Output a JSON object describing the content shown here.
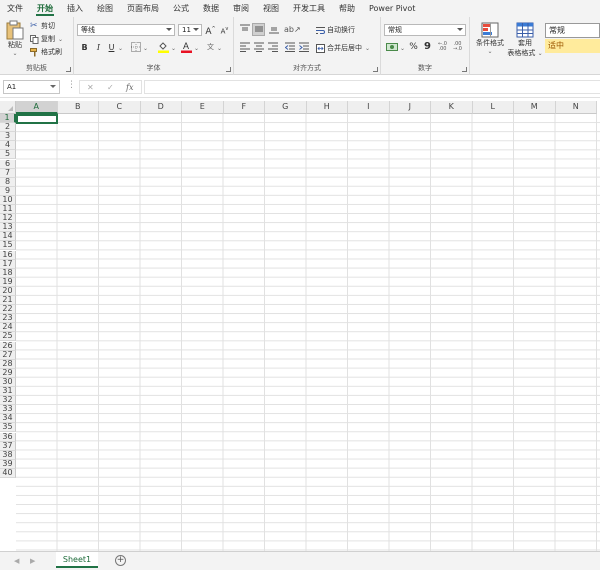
{
  "tabs": [
    "文件",
    "开始",
    "插入",
    "绘图",
    "页面布局",
    "公式",
    "数据",
    "审阅",
    "视图",
    "开发工具",
    "帮助",
    "Power Pivot"
  ],
  "active_tab": "开始",
  "clipboard": {
    "paste": "粘贴",
    "cut": "剪切",
    "copy": "复制",
    "format_painter": "格式刷",
    "label": "剪贴板"
  },
  "font": {
    "name": "等线",
    "size": "11",
    "bold": "B",
    "italic": "I",
    "underline": "U",
    "grow": "A",
    "shrink": "A",
    "label": "字体"
  },
  "alignment": {
    "wrap_text": "自动换行",
    "merge_center": "合并后居中",
    "label": "对齐方式"
  },
  "number": {
    "format": "常规",
    "percent": "%",
    "comma": "9",
    "label": "数字"
  },
  "styles": {
    "conditional": "条件格式",
    "table_line1": "套用",
    "table_line2": "表格格式",
    "style_normal": "常规",
    "style_neutral": "适中"
  },
  "formula_bar": {
    "name_box": "A1",
    "fx": "fx",
    "cancel": "✕",
    "enter": "✓",
    "value": ""
  },
  "columns": [
    "A",
    "B",
    "C",
    "D",
    "E",
    "F",
    "G",
    "H",
    "I",
    "J",
    "K",
    "L",
    "M",
    "N"
  ],
  "row_count": 40,
  "sheet": {
    "tab": "Sheet1",
    "add": "+"
  },
  "colors": {
    "accent": "#217346",
    "neutral_style_bg": "#ffeb9c",
    "neutral_style_text": "#9c5700"
  }
}
